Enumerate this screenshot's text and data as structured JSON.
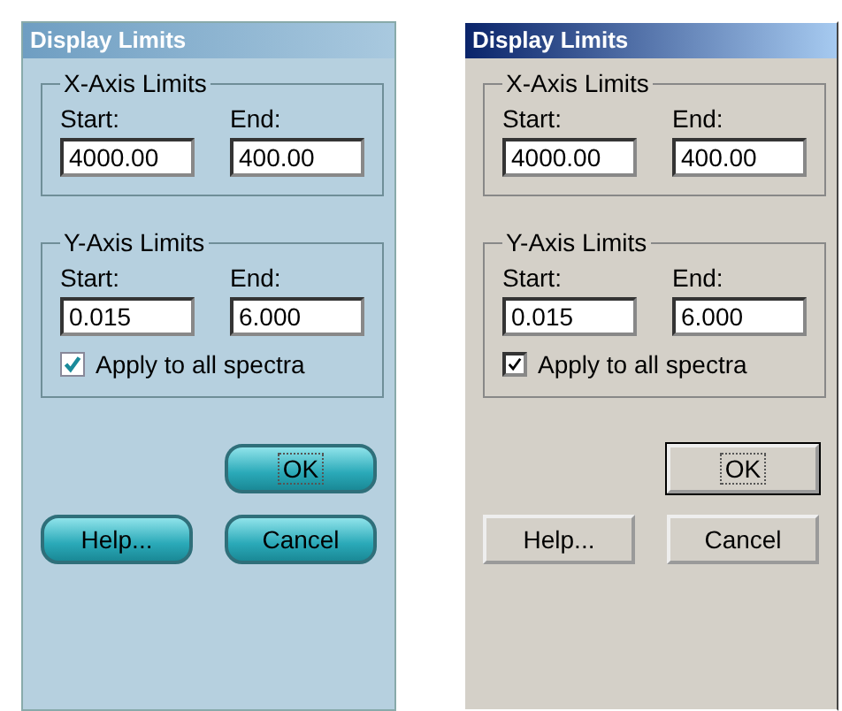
{
  "dialogs": [
    {
      "kind": "textured",
      "title": "Display Limits",
      "groups": [
        {
          "legend": "X-Axis Limits",
          "fields": [
            {
              "label": "Start:",
              "value": "4000.00"
            },
            {
              "label": "End:",
              "value": "400.00"
            }
          ]
        },
        {
          "legend": "Y-Axis Limits",
          "fields": [
            {
              "label": "Start:",
              "value": "0.015"
            },
            {
              "label": "End:",
              "value": "6.000"
            }
          ],
          "checkbox": {
            "label": "Apply to all spectra",
            "checked": true
          }
        }
      ],
      "default_button": {
        "label": "OK"
      },
      "buttons": [
        {
          "label": "Help..."
        },
        {
          "label": "Cancel"
        }
      ]
    },
    {
      "kind": "classic",
      "title": "Display Limits",
      "groups": [
        {
          "legend": "X-Axis Limits",
          "fields": [
            {
              "label": "Start:",
              "value": "4000.00"
            },
            {
              "label": "End:",
              "value": "400.00"
            }
          ]
        },
        {
          "legend": "Y-Axis Limits",
          "fields": [
            {
              "label": "Start:",
              "value": "0.015"
            },
            {
              "label": "End:",
              "value": "6.000"
            }
          ],
          "checkbox": {
            "label": "Apply to all spectra",
            "checked": true
          }
        }
      ],
      "default_button": {
        "label": "OK"
      },
      "buttons": [
        {
          "label": "Help..."
        },
        {
          "label": "Cancel"
        }
      ]
    }
  ]
}
